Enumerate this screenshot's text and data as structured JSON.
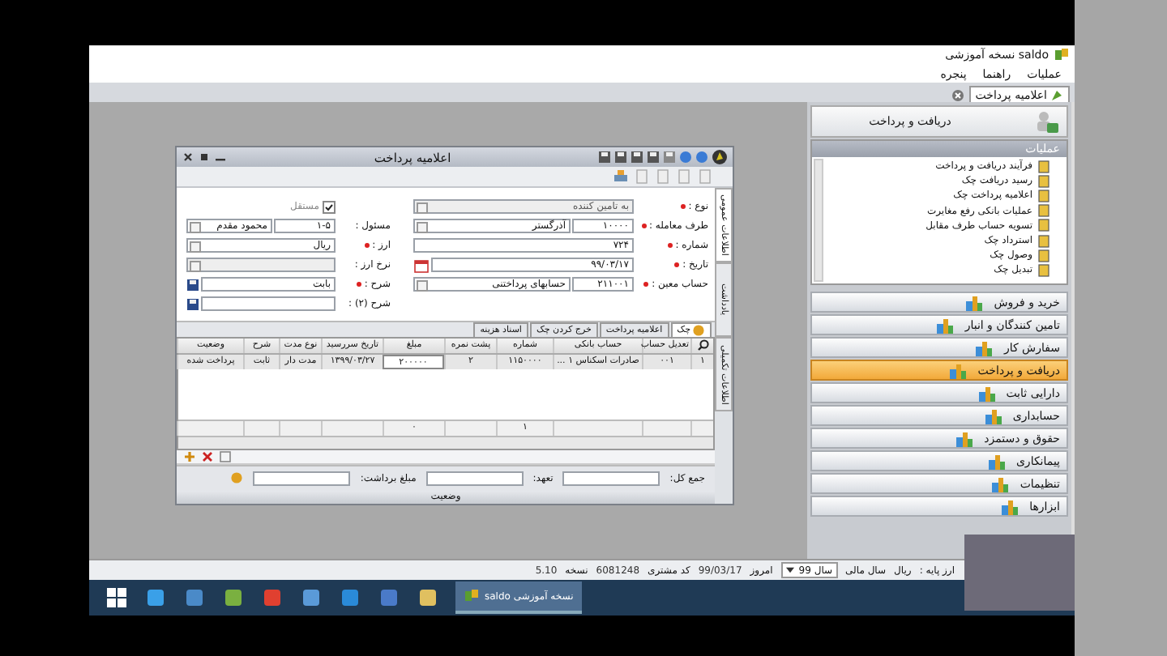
{
  "app": {
    "title": "saldo نسخه آموزشی",
    "menu": [
      "عملیات",
      "راهنما",
      "پنجره"
    ]
  },
  "doc_tabs": [
    {
      "label": "اعلامیه پرداخت",
      "selected": true
    }
  ],
  "window": {
    "title": "اعلامیه پرداخت",
    "side_tabs": [
      {
        "label": "اطلاعات عمومی",
        "selected": true
      },
      {
        "label": "یادداشت",
        "selected": false
      },
      {
        "label": "اطلاعات تکمیلی",
        "selected": false
      }
    ],
    "form_right": [
      {
        "label": "نوع :",
        "required": true,
        "kind": "dropdown",
        "value": "به تامین کننده",
        "disabled": true
      },
      {
        "label": "طرف معامله :",
        "required": true,
        "kind": "code_dropdown",
        "code": "۱۰۰۰۰",
        "value": "آذرگستر",
        "disabled": false
      },
      {
        "label": "شماره :",
        "required": true,
        "kind": "text",
        "value": "۷۲۴",
        "disabled": false
      },
      {
        "label": "تاریخ :",
        "required": true,
        "kind": "date",
        "value": "۹۹/۰۳/۱۷",
        "disabled": false
      },
      {
        "label": "حساب معین :",
        "required": true,
        "kind": "code_dropdown",
        "code": "۲۱۱۰۰۱",
        "value": "حسابهای پرداختنی",
        "disabled": false
      }
    ],
    "form_left": [
      {
        "label": "مستقل",
        "required": false,
        "kind": "checkbox",
        "checked": true,
        "disabled": true
      },
      {
        "label": "مسئول :",
        "required": false,
        "kind": "code_dropdown",
        "code": "۱-۵",
        "value": "محمود مقدم",
        "disabled": false
      },
      {
        "label": "ارز :",
        "required": true,
        "kind": "dropdown",
        "value": "ریال",
        "disabled": false
      },
      {
        "label": "نرخ ارز :",
        "required": false,
        "kind": "dropdown",
        "disabled": true
      },
      {
        "label": "شرح :",
        "required": true,
        "kind": "memo",
        "value": "بابت",
        "disabled": false
      },
      {
        "label": "شرح (۲) :",
        "required": false,
        "kind": "memo",
        "disabled": false
      }
    ],
    "grid_tabs": [
      {
        "label": "چک",
        "selected": true
      },
      {
        "label": "اعلامیه پرداخت",
        "selected": false
      },
      {
        "label": "خرج کردن چک",
        "selected": false
      },
      {
        "label": "اسناد هزینه",
        "selected": false
      }
    ],
    "table": {
      "columns": [
        "تعدیل حساب",
        "حساب بانکی",
        "شماره",
        "پشت نمره",
        "مبلغ",
        "تاریخ سررسید",
        "نوع مدت",
        "شرح",
        "وضعیت"
      ],
      "rows": [
        {
          "number": "۱",
          "cells": [
            "۰۰۱",
            "صادرات اسکناس ۱ ...",
            "۱۱۵۰۰۰۰",
            "۲",
            "۲۰۰۰۰۰",
            "۱۳۹۹/۰۳/۲۷",
            "مدت دار",
            "ثابت",
            "پرداخت شده"
          ]
        }
      ],
      "totals": {
        "number": "۱",
        "amount": "۰"
      }
    },
    "summary": [
      {
        "label": "جمع کل:"
      },
      {
        "label": "تعهد:"
      },
      {
        "label": "مبلغ برداشت:"
      }
    ],
    "status": "وضعیت"
  },
  "sidebar": {
    "header": "دریافت و پرداخت",
    "pane_title": "عملیات",
    "tasks": [
      "فرآیند دریافت و پرداخت",
      "رسید دریافت چک",
      "اعلامیه پرداخت چک",
      "عملیات بانکی رفع مغایرت",
      "تسویه حساب طرف مقابل",
      "استرداد چک",
      "وصول چک",
      "تبدیل چک"
    ],
    "modules": [
      {
        "label": "خرید و فروش",
        "selected": false
      },
      {
        "label": "تامین کنندگان و انبار",
        "selected": false
      },
      {
        "label": "سفارش کار",
        "selected": false
      },
      {
        "label": "دریافت و پرداخت",
        "selected": true
      },
      {
        "label": "دارایی ثابت",
        "selected": false
      },
      {
        "label": "حسابداری",
        "selected": false
      },
      {
        "label": "حقوق و دستمزد",
        "selected": false
      },
      {
        "label": "پیمانکاری",
        "selected": false
      },
      {
        "label": "تنظیمات",
        "selected": false
      },
      {
        "label": "ابزارها",
        "selected": false
      }
    ]
  },
  "status_bar": [
    {
      "kind": "text",
      "text": "ارز پایه :"
    },
    {
      "kind": "text",
      "text": "ریال"
    },
    {
      "kind": "text",
      "text": "سال مالی"
    },
    {
      "kind": "dropdown",
      "text": "سال 99"
    },
    {
      "kind": "text",
      "text": "امروز"
    },
    {
      "kind": "value",
      "text": "99/03/17"
    },
    {
      "kind": "text",
      "text": "کد مشتری"
    },
    {
      "kind": "value",
      "text": "6081248"
    },
    {
      "kind": "text",
      "text": "نسخه"
    },
    {
      "kind": "value",
      "text": "5.10"
    }
  ],
  "taskbar": {
    "apps": [
      {
        "label": "saldo نسخه آموزشی",
        "selected": true
      }
    ]
  }
}
